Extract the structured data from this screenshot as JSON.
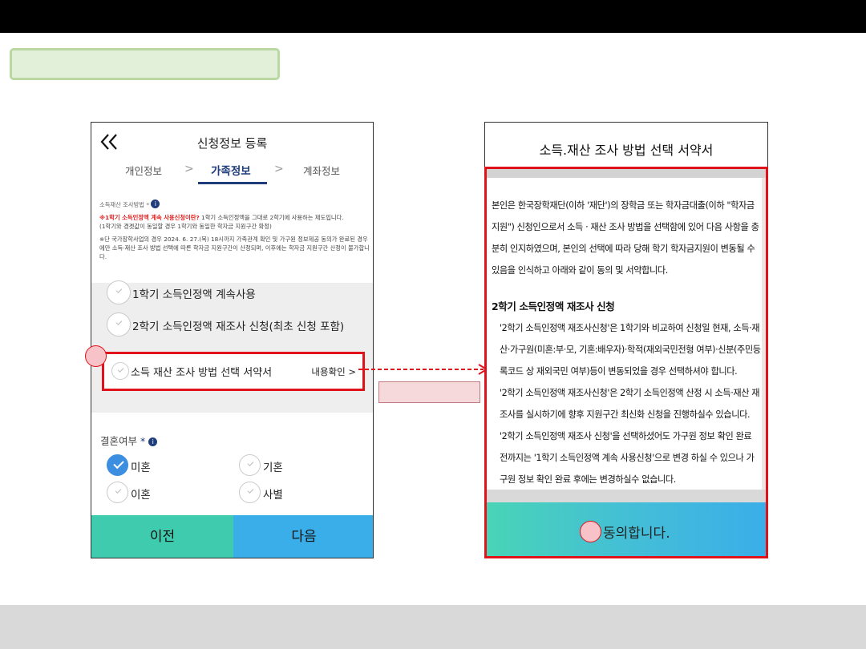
{
  "left_screen": {
    "title": "신청정보 등록",
    "tabs": [
      {
        "label": "개인정보",
        "active": false
      },
      {
        "label": "가족정보",
        "active": true
      },
      {
        "label": "계좌정보",
        "active": false
      }
    ],
    "tab_separator": ">",
    "notice": {
      "section_label": "소득재산 조사방법 *",
      "line1_red": "※1학기 소득인정액 계속 사용신청이란?",
      "line1_rest": " 1학기 소득인정액을 그대로 2학기에 사용하는 제도입니다.",
      "line2": "(1학기와 경곗값이 동일할 경우 1학기와 동일한 학자금 지원구간 확정)",
      "line3": "※단 국가장학사업의 경우 2024. 6. 27.(목) 18시까지 가족관계 확인 및 가구원 정보제공 동의가 완료된 경우에만 소득·재산 조사 방법 선택에 따른 학자금 지원구간이 산정되며, 이후에는 학자금 지원구간 산정이 불가합니다."
    },
    "options": [
      {
        "label": "1학기 소득인정액 계속사용",
        "checked": false
      },
      {
        "label": "2학기 소득인정액 재조사 신청(최초 신청 포함)",
        "checked": false
      }
    ],
    "consent": {
      "label": "소득 재산 조사 방법 선택 서약서",
      "link_label": "내용확인 >"
    },
    "marriage": {
      "label": "결혼여부",
      "required_mark": "*",
      "info_icon": "i",
      "options": [
        {
          "label": "미혼",
          "checked": true
        },
        {
          "label": "기혼",
          "checked": false
        },
        {
          "label": "이혼",
          "checked": false
        },
        {
          "label": "사별",
          "checked": false
        }
      ]
    },
    "buttons": {
      "prev": "이전",
      "next": "다음"
    }
  },
  "right_screen": {
    "title": "소득.재산 조사 방법 선택 서약서",
    "intro": "본인은 한국장학재단(이하 '재단')의 장학금 또는 학자금대출(이하 \"학자금지원\") 신청인으로서 소득 · 재산 조사 방법을 선택함에 있어 다음 사항을 충분히 인지하였으며, 본인의 선택에 따라 당해 학기 학자금지원이 변동될 수 있음을 인식하고 아래와 같이 동의 및 서약합니다.",
    "section_heading": "2학기 소득인정액 재조사 신청",
    "items": [
      "'2학기 소득인정액 재조사신청'은 1학기와 비교하여 신청일 현재, 소득·재산·가구원(미혼:부·모, 기혼:배우자)·학적(재외국민전형 여부)·신분(주민등록코드 상 재외국민 여부)등이 변동되었을 경우 선택하셔야 합니다.",
      "'2학기 소득인정액 재조사신청'은 2학기 소득인정액 산정 시 소득·재산 재조사를 실시하기에 향후 지원구간 최신화 신청을 진행하실수 있습니다.",
      "'2학기 소득인정액 재조사 신청'을 선택하셨어도 가구원 정보 확인 완료 전까지는 '1학기 소득인정액 계속 사용신청'으로 변경 하실 수 있으나 가구원 정보 확인 완료 후에는 변경하실수 없습니다."
    ],
    "agree_button": "동의합니다."
  },
  "colors": {
    "highlight_red": "#e0121a",
    "prev_button": "#3fcbad",
    "next_button": "#3aaee9",
    "active_tab": "#1f3d7a",
    "checked": "#3c8fe0"
  },
  "icons": [
    "double-chevron-left-icon",
    "info-icon",
    "check-circle-icon",
    "chevron-right-icon",
    "arrow-right-icon"
  ]
}
